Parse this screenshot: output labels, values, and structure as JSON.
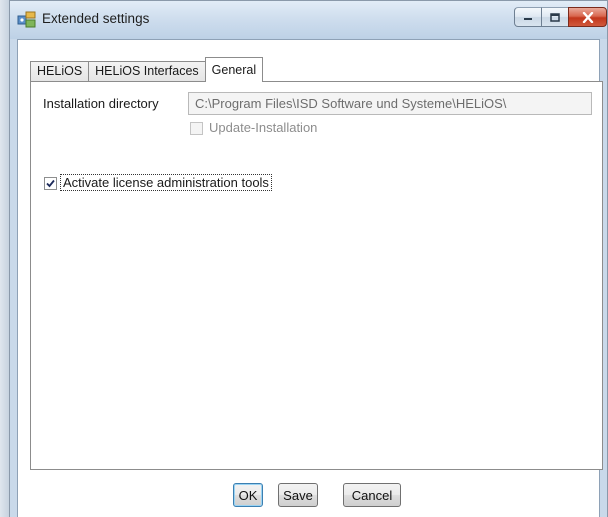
{
  "window": {
    "title": "Extended settings",
    "icon": "settings-app-icon"
  },
  "tabs": [
    {
      "label": "HELiOS",
      "active": false
    },
    {
      "label": "HELiOS Interfaces",
      "active": false
    },
    {
      "label": "General",
      "active": true
    }
  ],
  "general": {
    "install_dir_label": "Installation directory",
    "install_dir_value": "C:\\Program Files\\ISD Software und Systeme\\HELiOS\\",
    "update_installation_label": "Update-Installation",
    "update_installation_checked": false,
    "update_installation_enabled": false,
    "license_tools_label": "Activate license administration tools",
    "license_tools_checked": true
  },
  "buttons": {
    "ok": "OK",
    "save": "Save",
    "cancel": "Cancel"
  },
  "colors": {
    "titlebar": "#cfdeee",
    "close_button": "#c2361c",
    "default_button_border": "#3c7fb1"
  }
}
